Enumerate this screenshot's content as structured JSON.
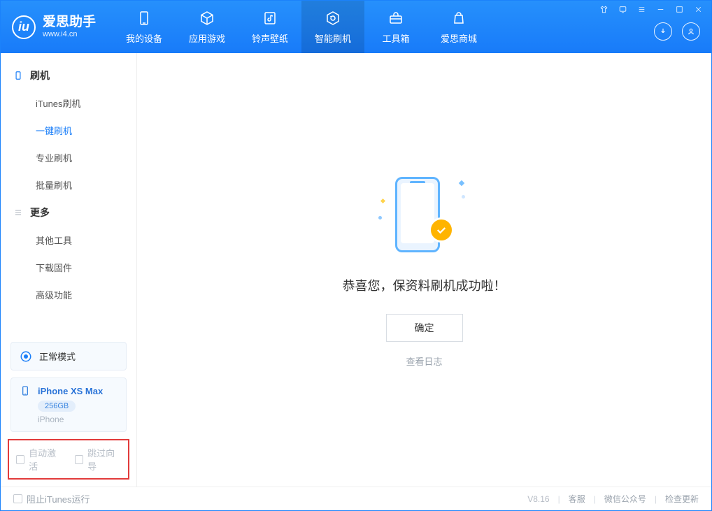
{
  "app": {
    "title": "爱思助手",
    "subtitle": "www.i4.cn"
  },
  "nav": {
    "items": [
      {
        "label": "我的设备",
        "icon": "device"
      },
      {
        "label": "应用游戏",
        "icon": "cube"
      },
      {
        "label": "铃声壁纸",
        "icon": "music"
      },
      {
        "label": "智能刷机",
        "icon": "refresh",
        "active": true
      },
      {
        "label": "工具箱",
        "icon": "toolbox"
      },
      {
        "label": "爱思商城",
        "icon": "store"
      }
    ]
  },
  "sidebar": {
    "group1": {
      "title": "刷机"
    },
    "items1": [
      {
        "label": "iTunes刷机"
      },
      {
        "label": "一键刷机",
        "active": true
      },
      {
        "label": "专业刷机"
      },
      {
        "label": "批量刷机"
      }
    ],
    "group2": {
      "title": "更多"
    },
    "items2": [
      {
        "label": "其他工具"
      },
      {
        "label": "下载固件"
      },
      {
        "label": "高级功能"
      }
    ],
    "mode": {
      "label": "正常模式"
    },
    "device": {
      "name": "iPhone XS Max",
      "storage": "256GB",
      "type": "iPhone"
    },
    "checks": {
      "auto_activate": "自动激活",
      "skip_guide": "跳过向导"
    }
  },
  "main": {
    "success_text": "恭喜您，保资料刷机成功啦！",
    "ok_label": "确定",
    "log_link": "查看日志"
  },
  "footer": {
    "block_itunes": "阻止iTunes运行",
    "version": "V8.16",
    "links": {
      "support": "客服",
      "wechat": "微信公众号",
      "update": "检查更新"
    }
  }
}
